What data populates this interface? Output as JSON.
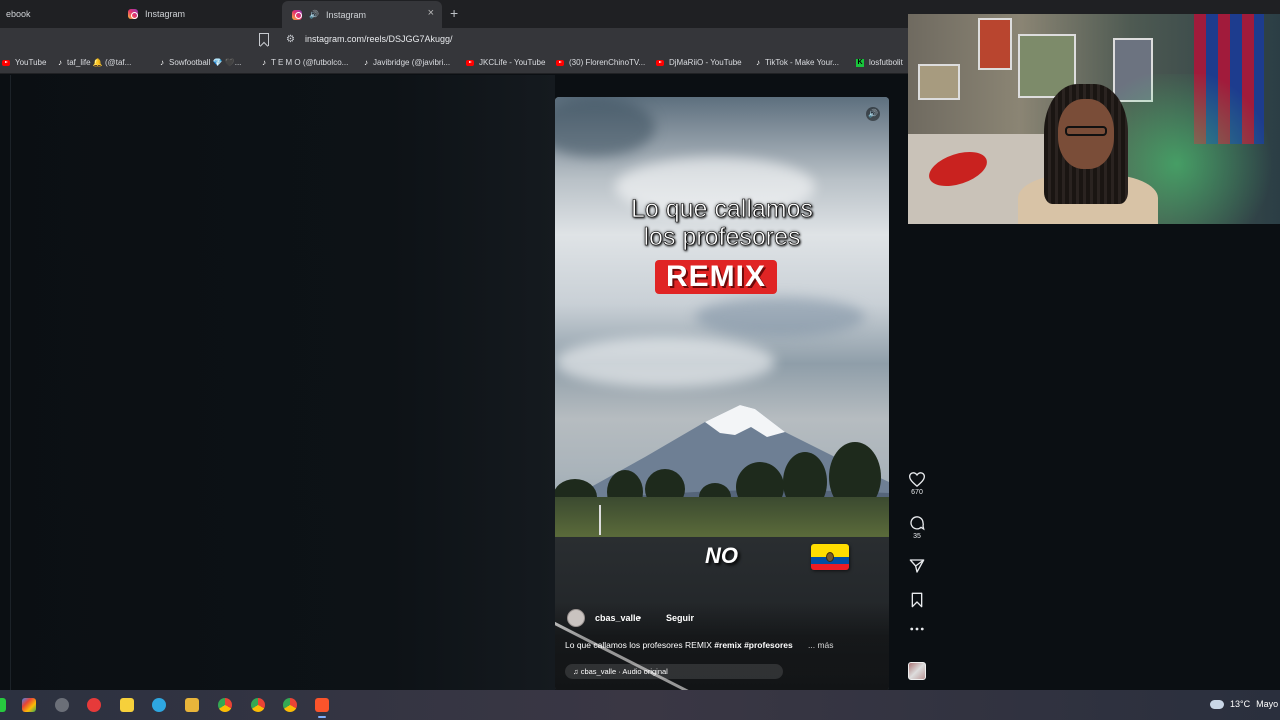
{
  "browser": {
    "tabs": [
      {
        "label": "ebook",
        "active": false
      },
      {
        "label": "Instagram",
        "active": false
      },
      {
        "label": "Instagram",
        "active": true
      }
    ],
    "tab_close": "×",
    "new_tab": "+",
    "url": "instagram.com/reels/DSJGG7Akugg/",
    "bookmarks": [
      {
        "label": "YouTube",
        "icon": "youtube-icon"
      },
      {
        "label": "taf_life 🔔 (@taf...",
        "icon": "tiktok-icon"
      },
      {
        "label": "Sowfootball 💎 🖤...",
        "icon": "tiktok-icon"
      },
      {
        "label": "T E M O (@futbolco...",
        "icon": "tiktok-icon"
      },
      {
        "label": "Javibridge (@javibri...",
        "icon": "tiktok-icon"
      },
      {
        "label": "JKCLife - YouTube",
        "icon": "youtube-icon"
      },
      {
        "label": "(30) FlorenChinoTV...",
        "icon": "youtube-icon"
      },
      {
        "label": "DjMaRiiO - YouTube",
        "icon": "youtube-icon"
      },
      {
        "label": "TikTok - Make Your...",
        "icon": "tiktok-icon"
      },
      {
        "label": "losfutbolit",
        "icon": "kick-icon"
      }
    ]
  },
  "reel": {
    "title_line1": "Lo que callamos",
    "title_line2": "los profesores",
    "remix_label": "REMIX",
    "overlay_word": "NO",
    "username": "cbas_valle",
    "separator": "•",
    "follow_label": "Seguir",
    "caption_text": "Lo que callamos los profesores REMIX ",
    "caption_tags": "#remix #profesores",
    "caption_more": "... más",
    "audio_label": "♫ cbas_valle · Audio original"
  },
  "actions": {
    "likes": "670",
    "comments": "35"
  },
  "taskbar": {
    "weather_temp": "13°C",
    "weather_text": "Mayo"
  },
  "colors": {
    "accent_red": "#e02424",
    "instagram_gradient": "#e6306b",
    "background": "#0b0f13"
  }
}
